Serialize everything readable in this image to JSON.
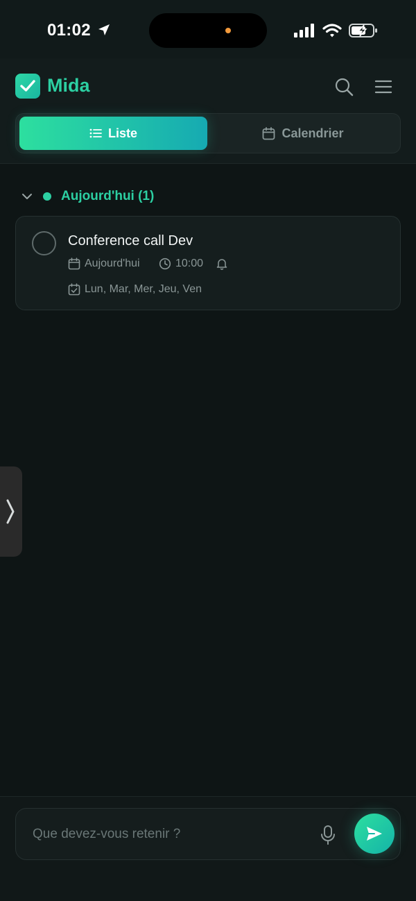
{
  "status_bar": {
    "time": "01:02",
    "icons": [
      "location-arrow-icon",
      "signal-bars-icon",
      "wifi-icon",
      "battery-charging-icon"
    ],
    "island_dot_color": "#f39a3c"
  },
  "header": {
    "app_name": "Mida",
    "logo_icon": "checkbox-icon",
    "search_icon": "search-icon",
    "menu_icon": "hamburger-menu-icon",
    "brand_color": "#2ccfa2"
  },
  "tabs": [
    {
      "label": "Liste",
      "icon": "list-icon",
      "active": true
    },
    {
      "label": "Calendrier",
      "icon": "calendar-icon",
      "active": false
    }
  ],
  "section": {
    "title": "Aujourd'hui (1)",
    "expanded": true
  },
  "tasks": [
    {
      "title": "Conference call Dev",
      "date": "Aujourd'hui",
      "time": "10:00",
      "has_reminder": true,
      "repeat": "Lun, Mar, Mer, Jeu, Ven",
      "done": false
    }
  ],
  "composer": {
    "placeholder": "Que devez-vous retenir ?",
    "value": "",
    "mic_icon": "microphone-icon",
    "send_icon": "send-icon"
  }
}
